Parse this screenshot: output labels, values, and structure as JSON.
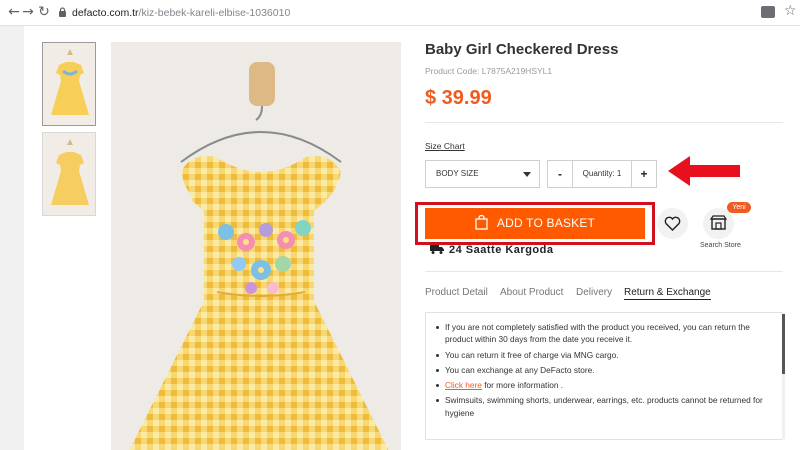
{
  "browser": {
    "url_host": "defacto.com.tr",
    "url_path": "/kiz-bebek-kareli-elbise-1036010",
    "back_icon": "arrow-left-icon",
    "forward_icon": "arrow-right-icon",
    "reload_icon": "reload-icon"
  },
  "product": {
    "title": "Baby Girl Checkered Dress",
    "code": "Product Code: L7875A219HSYL1",
    "price": "$ 39.99"
  },
  "size": {
    "chart_link": "Size Chart",
    "selected": "BODY SIZE"
  },
  "quantity": {
    "minus": "-",
    "label": "Quantity: 1",
    "plus": "+"
  },
  "actions": {
    "add_to_basket": "ADD TO BASKET",
    "search_store": "Search Store",
    "new_badge": "Yeni"
  },
  "shipping": {
    "text": "24 Saatte Kargoda"
  },
  "tabs": [
    {
      "label": "Product Detail"
    },
    {
      "label": "About Product"
    },
    {
      "label": "Delivery"
    },
    {
      "label": "Return & Exchange"
    }
  ],
  "details": {
    "items": [
      "If you are not completely satisfied with the product you received, you can return the product within 30 days from the date you receive it.",
      "You can return it free of charge via MNG cargo.",
      "You can exchange at any DeFacto store.",
      "",
      "Swimsuits, swimming shorts, underwear, earrings, etc. products cannot be returned for hygiene"
    ],
    "link_text": "Click here",
    "link_suffix": " for more information ."
  },
  "colors": {
    "accent": "#ff5a00",
    "price": "#ef5b20",
    "highlight": "#d20f1d"
  }
}
